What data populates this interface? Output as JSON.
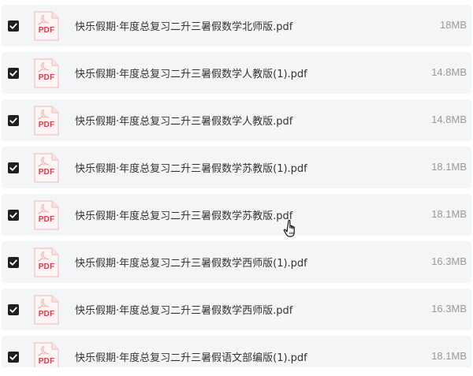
{
  "file_type_label": "PDF",
  "files": [
    {
      "name": "快乐假期·年度总复习二升三暑假数学北师版.pdf",
      "size": "18MB",
      "checked": true
    },
    {
      "name": "快乐假期·年度总复习二升三暑假数学人教版(1).pdf",
      "size": "14.8MB",
      "checked": true
    },
    {
      "name": "快乐假期·年度总复习二升三暑假数学人教版.pdf",
      "size": "14.8MB",
      "checked": true
    },
    {
      "name": "快乐假期·年度总复习二升三暑假数学苏教版(1).pdf",
      "size": "18.1MB",
      "checked": true
    },
    {
      "name": "快乐假期·年度总复习二升三暑假数学苏教版.pdf",
      "size": "18.1MB",
      "checked": true
    },
    {
      "name": "快乐假期·年度总复习二升三暑假数学西师版(1).pdf",
      "size": "16.3MB",
      "checked": true
    },
    {
      "name": "快乐假期·年度总复习二升三暑假数学西师版.pdf",
      "size": "16.3MB",
      "checked": true
    },
    {
      "name": "快乐假期·年度总复习二升三暑假语文部编版(1).pdf",
      "size": "18.1MB",
      "checked": true
    }
  ],
  "colors": {
    "row_background": "#f4f5f7",
    "checkbox": "#1f1f1f",
    "pdf_red": "#e4393c",
    "file_name": "#333333",
    "file_size": "#999999"
  },
  "icons": {
    "checkbox": "checkbox-checked-icon",
    "file": "pdf-file-icon",
    "cursor": "hand-pointer-cursor-icon"
  }
}
